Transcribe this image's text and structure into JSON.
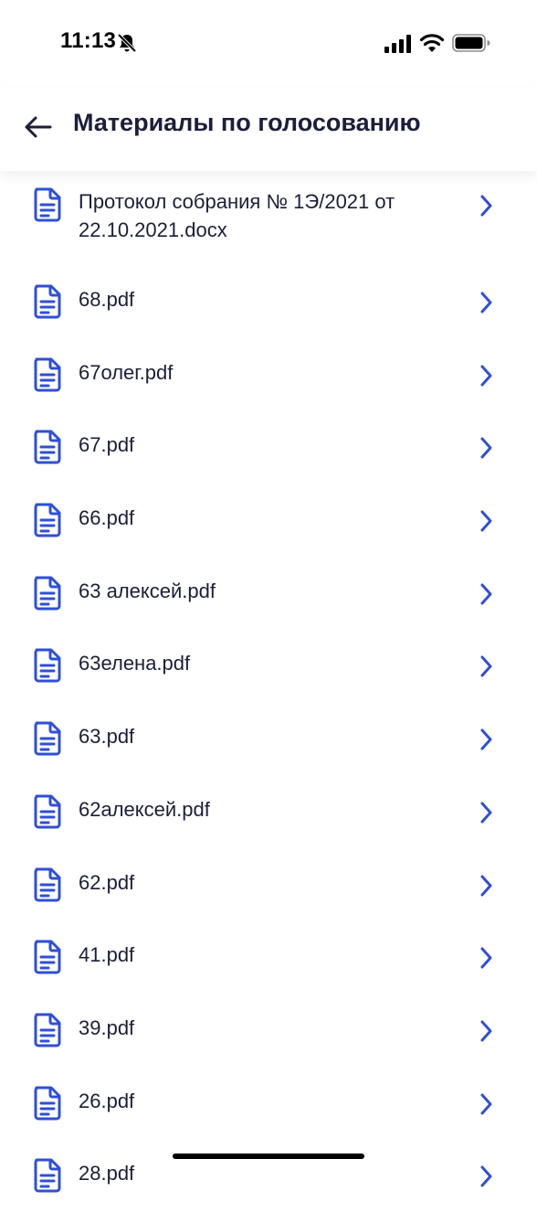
{
  "status_bar": {
    "time": "11:13"
  },
  "header": {
    "title": "Материалы по голосованию"
  },
  "colors": {
    "accent": "#2f4fd6",
    "text": "#1c1e3a"
  },
  "files": [
    {
      "name": "Протокол собрания № 1Э/2021 от 22.10.2021.docx"
    },
    {
      "name": "68.pdf"
    },
    {
      "name": "67олег.pdf"
    },
    {
      "name": "67.pdf"
    },
    {
      "name": "66.pdf"
    },
    {
      "name": "63 алексей.pdf"
    },
    {
      "name": "63елена.pdf"
    },
    {
      "name": "63.pdf"
    },
    {
      "name": "62алексей.pdf"
    },
    {
      "name": "62.pdf"
    },
    {
      "name": "41.pdf"
    },
    {
      "name": "39.pdf"
    },
    {
      "name": "26.pdf"
    },
    {
      "name": "28.pdf"
    }
  ]
}
